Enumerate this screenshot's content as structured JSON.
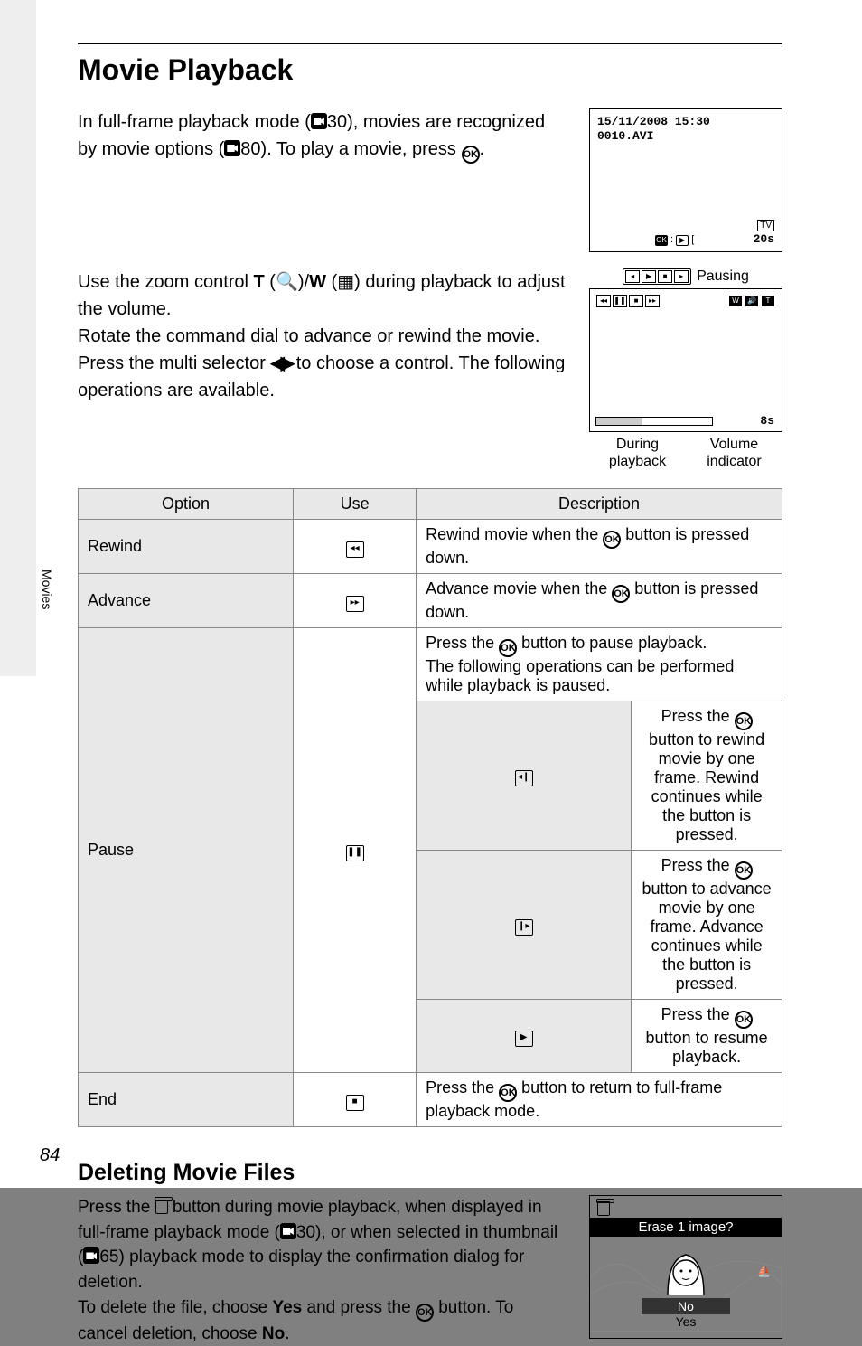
{
  "page_number": "84",
  "side_tab": "Movies",
  "title": "Movie Playback",
  "intro": {
    "p1a": "In full-frame playback mode (",
    "p1b": "30), movies are recognized by movie options (",
    "p1c": "80). To play a movie, press ",
    "p1d": "."
  },
  "screen1": {
    "date": "15/11/2008 15:30",
    "file": "0010.AVI",
    "tv": "TV",
    "duration": "20s"
  },
  "zoom_block": {
    "p2a": "Use the zoom control ",
    "t": "T",
    "p2b": " (",
    "p2c": ")/",
    "w": "W",
    "p2d": " (",
    "p2e": ") during playback to adjust the volume.",
    "p3": "Rotate the command dial to advance or rewind the movie.",
    "p4a": "Press the multi selector ",
    "p4b": " to choose a control. The following operations are available."
  },
  "pb_diagram": {
    "pausing": "Pausing",
    "time_left": "8s",
    "during": "During playback",
    "volume": "Volume indicator"
  },
  "table": {
    "headers": {
      "option": "Option",
      "use": "Use",
      "description": "Description"
    },
    "rows": {
      "rewind": {
        "option": "Rewind",
        "desc_a": "Rewind movie when the ",
        "desc_b": " button is pressed down."
      },
      "advance": {
        "option": "Advance",
        "desc_a": "Advance movie when the ",
        "desc_b": " button is pressed down."
      },
      "pause": {
        "option": "Pause",
        "desc_top_a": "Press the ",
        "desc_top_b": " button to pause playback.",
        "desc_top_c": "The following operations can be performed while playback is paused.",
        "sub1_a": "Press the ",
        "sub1_b": " button to rewind movie by one frame. Rewind continues while the button is pressed.",
        "sub2_a": "Press the ",
        "sub2_b": " button to advance movie by one frame. Advance continues while the button is pressed.",
        "sub3_a": "Press the ",
        "sub3_b": " button to resume playback."
      },
      "end": {
        "option": "End",
        "desc_a": "Press the ",
        "desc_b": " button to return to full-frame playback mode."
      }
    }
  },
  "deleting": {
    "title": "Deleting Movie Files",
    "p1a": "Press the ",
    "p1b": " button during movie playback, when displayed in full-frame playback mode (",
    "p1c": "30), or when selected in thumbnail (",
    "p1d": "65) playback mode to display the confirmation dialog for deletion.",
    "p2a": "To delete the file, choose ",
    "yes": "Yes",
    "p2b": " and press the ",
    "p2c": " button. To cancel deletion, choose ",
    "no": "No",
    "p2d": "."
  },
  "erase_screen": {
    "title": "Erase 1 image?",
    "no": "No",
    "yes": "Yes"
  }
}
